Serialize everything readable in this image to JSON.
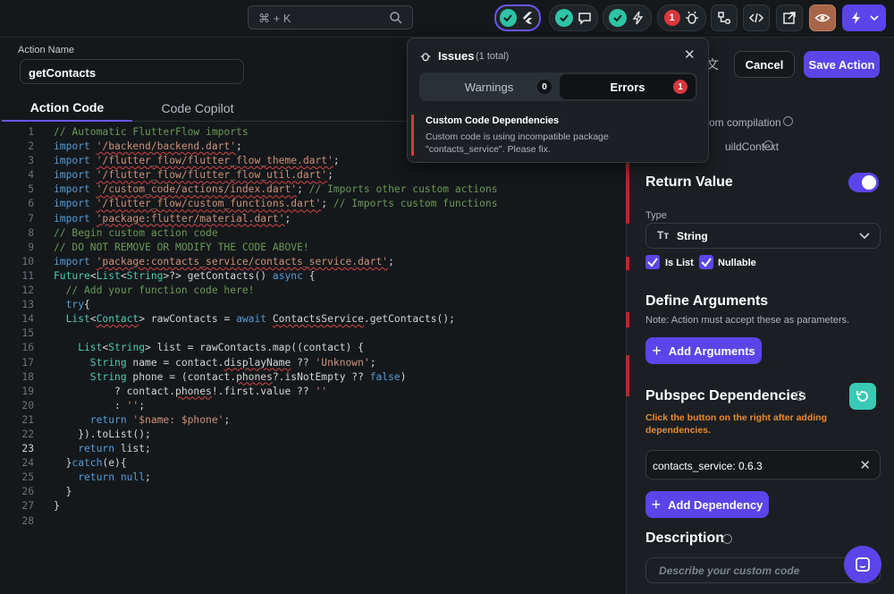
{
  "topbar": {
    "search_shortcut": "⌘ + K",
    "issues_count": "1"
  },
  "action": {
    "name_label": "Action Name",
    "name_value": "getContacts"
  },
  "tabs": [
    {
      "label": "Action Code"
    },
    {
      "label": "Code Copilot"
    }
  ],
  "code": {
    "lines": [
      {
        "n": "1",
        "t": [
          [
            "c-cm",
            "// Automatic FlutterFlow imports"
          ]
        ]
      },
      {
        "n": "2",
        "t": [
          [
            "c-kw",
            "import "
          ],
          [
            "c-str squig",
            "'/backend/backend.dart'"
          ],
          [
            "c-pl",
            ";"
          ]
        ]
      },
      {
        "n": "3",
        "t": [
          [
            "c-kw",
            "import "
          ],
          [
            "c-str squig",
            "'/flutter_flow/flutter_flow_theme.dart'"
          ],
          [
            "c-pl",
            ";"
          ]
        ]
      },
      {
        "n": "4",
        "t": [
          [
            "c-kw",
            "import "
          ],
          [
            "c-str squig",
            "'/flutter_flow/flutter_flow_util.dart'"
          ],
          [
            "c-pl",
            ";"
          ]
        ]
      },
      {
        "n": "5",
        "t": [
          [
            "c-kw",
            "import "
          ],
          [
            "c-str squig",
            "'/custom_code/actions/index.dart'"
          ],
          [
            "c-pl",
            "; "
          ],
          [
            "c-cm",
            "// Imports other custom actions"
          ]
        ]
      },
      {
        "n": "6",
        "t": [
          [
            "c-kw",
            "import "
          ],
          [
            "c-str squig",
            "'/flutter_flow/custom_functions.dart'"
          ],
          [
            "c-pl",
            "; "
          ],
          [
            "c-cm",
            "// Imports custom functions"
          ]
        ]
      },
      {
        "n": "7",
        "t": [
          [
            "c-kw",
            "import "
          ],
          [
            "c-str squig",
            "'package:flutter/material.dart'"
          ],
          [
            "c-pl",
            ";"
          ]
        ]
      },
      {
        "n": "8",
        "t": [
          [
            "c-cm",
            "// Begin custom action code"
          ]
        ]
      },
      {
        "n": "9",
        "t": [
          [
            "c-cm",
            "// DO NOT REMOVE OR MODIFY THE CODE ABOVE!"
          ]
        ]
      },
      {
        "n": "10",
        "t": [
          [
            "c-kw",
            "import "
          ],
          [
            "c-str squig",
            "'package:contacts_service/contacts_service.dart'"
          ],
          [
            "c-pl",
            ";"
          ]
        ]
      },
      {
        "n": "11",
        "t": [
          [
            "c-ty",
            "Future"
          ],
          [
            "c-pl",
            "<"
          ],
          [
            "c-ty",
            "List"
          ],
          [
            "c-pl",
            "<"
          ],
          [
            "c-ty",
            "String"
          ],
          [
            "c-pl",
            ">?> getContacts() "
          ],
          [
            "c-kw",
            "async"
          ],
          [
            "c-pl",
            " {"
          ]
        ]
      },
      {
        "n": "12",
        "t": [
          [
            "c-cm",
            "  // Add your function code here!"
          ]
        ]
      },
      {
        "n": "13",
        "t": [
          [
            "c-kw",
            "  try"
          ],
          [
            "c-pl",
            "{"
          ]
        ]
      },
      {
        "n": "14",
        "t": [
          [
            "c-ty",
            "  List"
          ],
          [
            "c-pl",
            "<"
          ],
          [
            "c-ty squig",
            "Contact"
          ],
          [
            "c-pl",
            "> rawContacts = "
          ],
          [
            "c-kw",
            "await "
          ],
          [
            "c-pl squig",
            "ContactsService"
          ],
          [
            "c-pl",
            ".getContacts();"
          ]
        ]
      },
      {
        "n": "15",
        "t": [
          [
            "c-pl",
            ""
          ]
        ]
      },
      {
        "n": "16",
        "t": [
          [
            "c-ty",
            "    List"
          ],
          [
            "c-pl",
            "<"
          ],
          [
            "c-ty",
            "String"
          ],
          [
            "c-pl",
            "> list = rawContacts.map((contact) {"
          ]
        ]
      },
      {
        "n": "17",
        "t": [
          [
            "c-ty",
            "      String"
          ],
          [
            "c-pl",
            " name = contact."
          ],
          [
            "c-pl squig",
            "displayName"
          ],
          [
            "c-pl",
            " ?? "
          ],
          [
            "c-str",
            "'Unknown'"
          ],
          [
            "c-pl",
            ";"
          ]
        ]
      },
      {
        "n": "18",
        "t": [
          [
            "c-ty",
            "      String"
          ],
          [
            "c-pl",
            " phone = (contact."
          ],
          [
            "c-pl squig",
            "phones"
          ],
          [
            "c-pl",
            "?.isNotEmpty ?? "
          ],
          [
            "c-kw",
            "false"
          ],
          [
            "c-pl",
            ")"
          ]
        ]
      },
      {
        "n": "19",
        "t": [
          [
            "c-pl",
            "          ? contact."
          ],
          [
            "c-pl squig",
            "phones"
          ],
          [
            "c-pl",
            "!.first.value ?? "
          ],
          [
            "c-str",
            "''"
          ]
        ]
      },
      {
        "n": "20",
        "t": [
          [
            "c-pl",
            "          : "
          ],
          [
            "c-str",
            "''"
          ],
          [
            "c-pl",
            ";"
          ]
        ]
      },
      {
        "n": "21",
        "t": [
          [
            "c-kw",
            "      return "
          ],
          [
            "c-str",
            "'$name: $phone'"
          ],
          [
            "c-pl",
            ";"
          ]
        ]
      },
      {
        "n": "22",
        "t": [
          [
            "c-pl",
            "    }).toList();"
          ]
        ]
      },
      {
        "n": "23",
        "t": [
          [
            "c-kw",
            "    return"
          ],
          [
            "c-pl",
            " list;"
          ]
        ]
      },
      {
        "n": "24",
        "t": [
          [
            "c-pl",
            "  }"
          ],
          [
            "c-kw",
            "catch"
          ],
          [
            "c-pl",
            "(e){"
          ]
        ]
      },
      {
        "n": "25",
        "t": [
          [
            "c-kw",
            "    return null"
          ],
          [
            "c-pl",
            ";"
          ]
        ]
      },
      {
        "n": "26",
        "t": [
          [
            "c-pl",
            "  }"
          ]
        ]
      },
      {
        "n": "27",
        "t": [
          [
            "c-pl",
            "}"
          ]
        ]
      },
      {
        "n": "28",
        "t": [
          [
            "c-pl",
            ""
          ]
        ]
      }
    ]
  },
  "issues_popup": {
    "title": "Issues",
    "total": "(1 total)",
    "warnings_label": "Warnings",
    "warnings_count": "0",
    "errors_label": "Errors",
    "errors_count": "1",
    "issue_title": "Custom Code Dependencies",
    "issue_body": "Custom code is using incompatible package \"contacts_service\". Please fix."
  },
  "header_actions": {
    "cancel_label": "Cancel",
    "save_label": "Save Action"
  },
  "right_panel": {
    "partial_row1": "om compilation",
    "partial_row2": "uildContext",
    "return_value_title": "Return Value",
    "type_label": "Type",
    "type_value": "String",
    "is_list_label": "Is List",
    "nullable_label": "Nullable",
    "define_args_title": "Define Arguments",
    "define_args_note": "Note: Action must accept these as parameters.",
    "add_args_label": "Add Arguments",
    "pubspec_title": "Pubspec Dependencies",
    "pubspec_note": "Click the button on the right after adding dependencies.",
    "dependency_value": "contacts_service: 0.6.3",
    "add_dependency_label": "Add Dependency",
    "description_title": "Description",
    "description_placeholder": "Describe your custom code"
  },
  "colors": {
    "accent": "#5b45ea",
    "error": "#d7383e",
    "teal": "#39c9b5",
    "warning_text": "#e88a2d"
  }
}
